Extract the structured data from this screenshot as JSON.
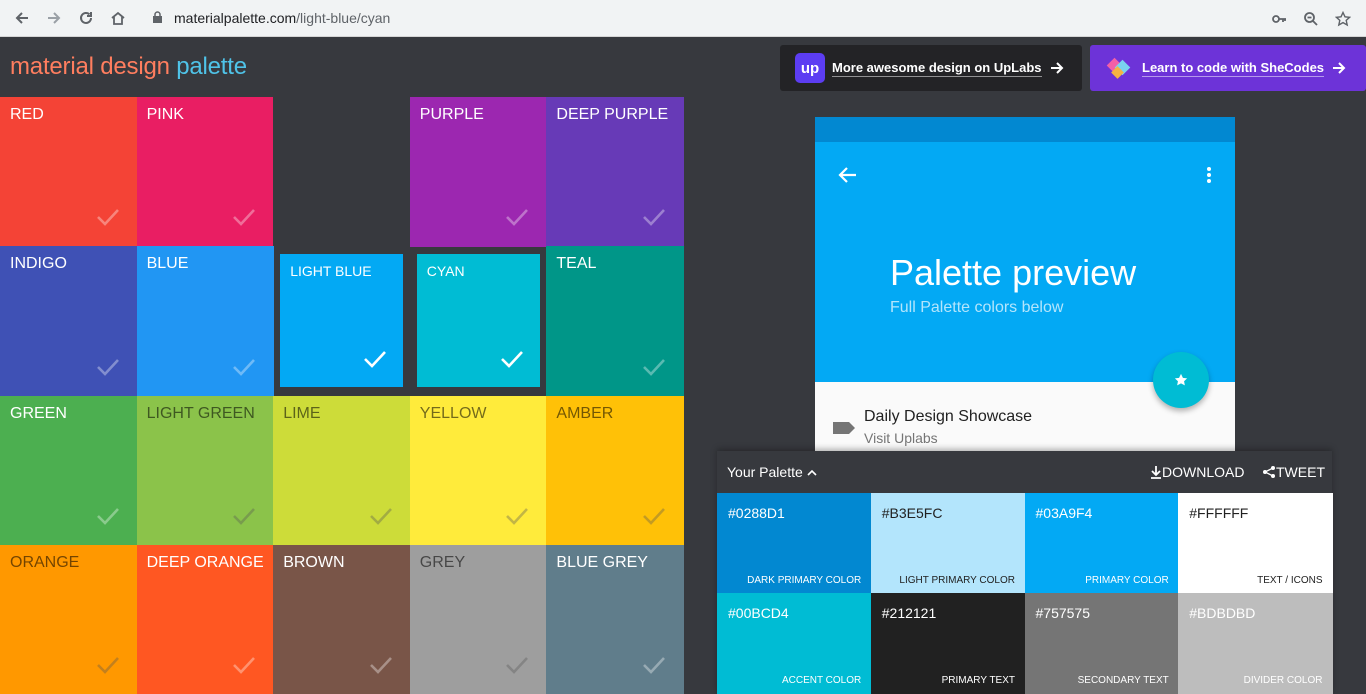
{
  "browser": {
    "url_host": "materialpalette.com",
    "url_path": "/light-blue/cyan"
  },
  "header": {
    "logo_part1": "material design",
    "logo_part2": "palette",
    "ad_uplabs": {
      "logo_text": "up",
      "label": "More awesome design on UpLabs",
      "color": "#232326",
      "logo_color": "#5c3df2"
    },
    "ad_shecodes": {
      "label": "Learn to code with SheCodes",
      "color": "#6d33d8"
    }
  },
  "grid": {
    "tiles": [
      {
        "name": "RED",
        "color": "#f44336",
        "dark": false
      },
      {
        "name": "PINK",
        "color": "#e91e63",
        "dark": false
      },
      {
        "name": "",
        "color": "#37393e",
        "dark": false
      },
      {
        "name": "PURPLE",
        "color": "#9c27b0",
        "dark": false
      },
      {
        "name": "DEEP PURPLE",
        "color": "#673ab7",
        "dark": false
      },
      {
        "name": "INDIGO",
        "color": "#3f51b5",
        "dark": false
      },
      {
        "name": "BLUE",
        "color": "#2196f3",
        "dark": false
      },
      {
        "name": "LIGHT BLUE",
        "color": "#03a9f4",
        "dark": false,
        "selected": true
      },
      {
        "name": "CYAN",
        "color": "#00bcd4",
        "dark": false,
        "selected": true
      },
      {
        "name": "TEAL",
        "color": "#009688",
        "dark": false
      },
      {
        "name": "GREEN",
        "color": "#4caf50",
        "dark": false
      },
      {
        "name": "LIGHT GREEN",
        "color": "#8bc34a",
        "dark": true
      },
      {
        "name": "LIME",
        "color": "#cddc39",
        "dark": true
      },
      {
        "name": "YELLOW",
        "color": "#ffeb3b",
        "dark": true
      },
      {
        "name": "AMBER",
        "color": "#ffc107",
        "dark": true
      },
      {
        "name": "ORANGE",
        "color": "#ff9800",
        "dark": true
      },
      {
        "name": "DEEP ORANGE",
        "color": "#ff5722",
        "dark": false
      },
      {
        "name": "BROWN",
        "color": "#795548",
        "dark": false
      },
      {
        "name": "GREY",
        "color": "#9e9e9e",
        "dark": true
      },
      {
        "name": "BLUE GREY",
        "color": "#607d8b",
        "dark": false
      }
    ]
  },
  "preview": {
    "title": "Palette preview",
    "subtitle": "Full Palette colors below",
    "list_title": "Daily Design Showcase",
    "list_subtitle": "Visit Uplabs"
  },
  "palette": {
    "title": "Your Palette",
    "download_label": "DOWNLOAD",
    "tweet_label": "TWEET",
    "swatches": [
      {
        "hex": "#0288D1",
        "name": "DARK PRIMARY COLOR",
        "color": "#0288d1",
        "text": "#ffffff"
      },
      {
        "hex": "#B3E5FC",
        "name": "LIGHT PRIMARY COLOR",
        "color": "#b3e5fc",
        "text": "#212121"
      },
      {
        "hex": "#03A9F4",
        "name": "PRIMARY COLOR",
        "color": "#03a9f4",
        "text": "#ffffff"
      },
      {
        "hex": "#FFFFFF",
        "name": "TEXT / ICONS",
        "color": "#ffffff",
        "text": "#212121"
      },
      {
        "hex": "#00BCD4",
        "name": "ACCENT COLOR",
        "color": "#00bcd4",
        "text": "#ffffff"
      },
      {
        "hex": "#212121",
        "name": "PRIMARY TEXT",
        "color": "#212121",
        "text": "#ffffff"
      },
      {
        "hex": "#757575",
        "name": "SECONDARY TEXT",
        "color": "#757575",
        "text": "#ffffff"
      },
      {
        "hex": "#BDBDBD",
        "name": "DIVIDER COLOR",
        "color": "#bdbdbd",
        "text": "#ffffff"
      }
    ]
  }
}
